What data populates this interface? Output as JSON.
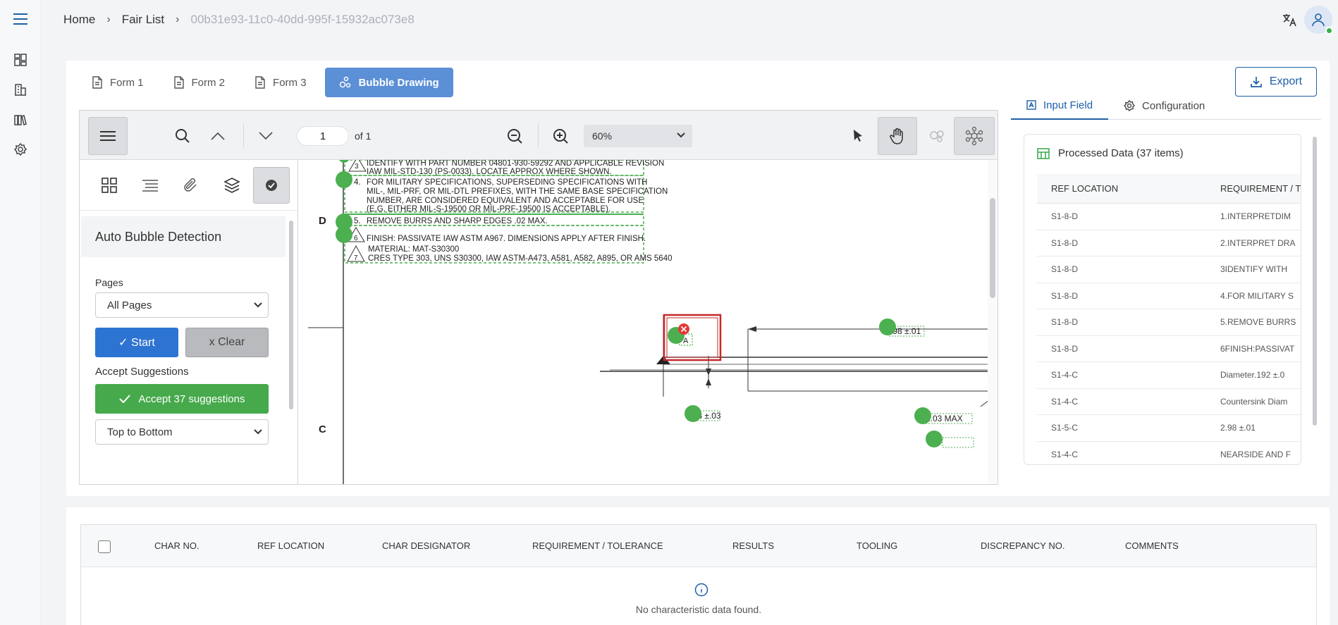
{
  "nav": {
    "icons": [
      "menu-icon",
      "dashboard-icon",
      "building-icon",
      "library-icon",
      "settings-icon"
    ]
  },
  "breadcrumb": {
    "home": "Home",
    "list": "Fair List",
    "id": "00b31e93-11c0-40dd-995f-15932ac073e8"
  },
  "tabs": [
    {
      "label": "Form 1"
    },
    {
      "label": "Form 2"
    },
    {
      "label": "Form 3"
    },
    {
      "label": "Bubble Drawing"
    }
  ],
  "export_label": "Export",
  "viewer": {
    "page_value": "1",
    "page_of": "of 1",
    "zoom": "60%"
  },
  "auto_bubble": {
    "title": "Auto Bubble Detection",
    "pages_label": "Pages",
    "pages_value": "All Pages",
    "start_label": "✓ Start",
    "clear_label": "x Clear",
    "accept_label": "Accept Suggestions",
    "accept_button": "Accept 37 suggestions",
    "order_value": "Top to Bottom"
  },
  "drawing": {
    "zone_d": "D",
    "zone_c": "C",
    "note3a": "IDENTIFY WITH PART NUMBER 04801-930-59292 AND APPLICABLE REVISION",
    "note3b": "IAW MIL-STD-130 (PS-0033). LOCATE APPROX WHERE SHOWN.",
    "note4a": "FOR MILITARY SPECIFICATIONS, SUPERSEDING SPECIFICATIONS WITH",
    "note4b": "MIL-, MIL-PRF, OR MIL-DTL PREFIXES, WITH THE SAME BASE SPECIFICATION",
    "note4c": "NUMBER, ARE CONSIDERED EQUIVALENT AND ACCEPTABLE FOR USE",
    "note4d": "(E.G. EITHER MIL-S-19500 OR MIL-PRF-19500 IS ACCEPTABLE).",
    "note5": "REMOVE BURRS AND SHARP EDGES .02 MAX.",
    "note6": "FINISH: PASSIVATE IAW ASTM A967. DIMENSIONS APPLY AFTER FINISH.",
    "note7a": "MATERIAL: MAT-S30300",
    "note7b": "CRES TYPE 303, UNS S30300, IAW ASTM-A473, A581, A582, A895, OR AMS 5640",
    "num3": "3",
    "num4": "4.",
    "num5": "5.",
    "num6": "6",
    "num7": "7",
    "dim1": ".98 ±.01",
    "dim2": ".3 ±.03",
    "dim3": "R.03 MAX",
    "datum": "A"
  },
  "right_panel": {
    "tab_input": "Input Field",
    "tab_config": "Configuration",
    "processed_title": "Processed Data (37 items)",
    "col_ref": "REF LOCATION",
    "col_req": "REQUIREMENT / T",
    "rows": [
      {
        "ref": "S1-8-D",
        "req": "1.INTERPRETDIM"
      },
      {
        "ref": "S1-8-D",
        "req": "2.INTERPRET DRA"
      },
      {
        "ref": "S1-8-D",
        "req": "3IDENTIFY WITH"
      },
      {
        "ref": "S1-8-D",
        "req": "4.FOR MILITARY S"
      },
      {
        "ref": "S1-8-D",
        "req": "5.REMOVE BURRS"
      },
      {
        "ref": "S1-8-D",
        "req": "6FINISH:PASSIVAT"
      },
      {
        "ref": "S1-4-C",
        "req": "Diameter.192 ±.0"
      },
      {
        "ref": "S1-4-C",
        "req": "Countersink Diam"
      },
      {
        "ref": "S1-5-C",
        "req": "2.98 ±.01"
      },
      {
        "ref": "S1-4-C",
        "req": "NEARSIDE AND F"
      }
    ]
  },
  "bottom_table": {
    "headers": [
      "CHAR NO.",
      "REF LOCATION",
      "CHAR DESIGNATOR",
      "REQUIREMENT / TOLERANCE",
      "RESULTS",
      "TOOLING",
      "DISCREPANCY NO.",
      "COMMENTS"
    ],
    "empty": "No characteristic data found."
  },
  "colors": {
    "accent": "#1d5fa8",
    "tab_active": "#5b8fd6",
    "start": "#2d73d2",
    "accept": "#46a94b",
    "bubble": "#4caf50",
    "highlight": "#d32f2f"
  }
}
